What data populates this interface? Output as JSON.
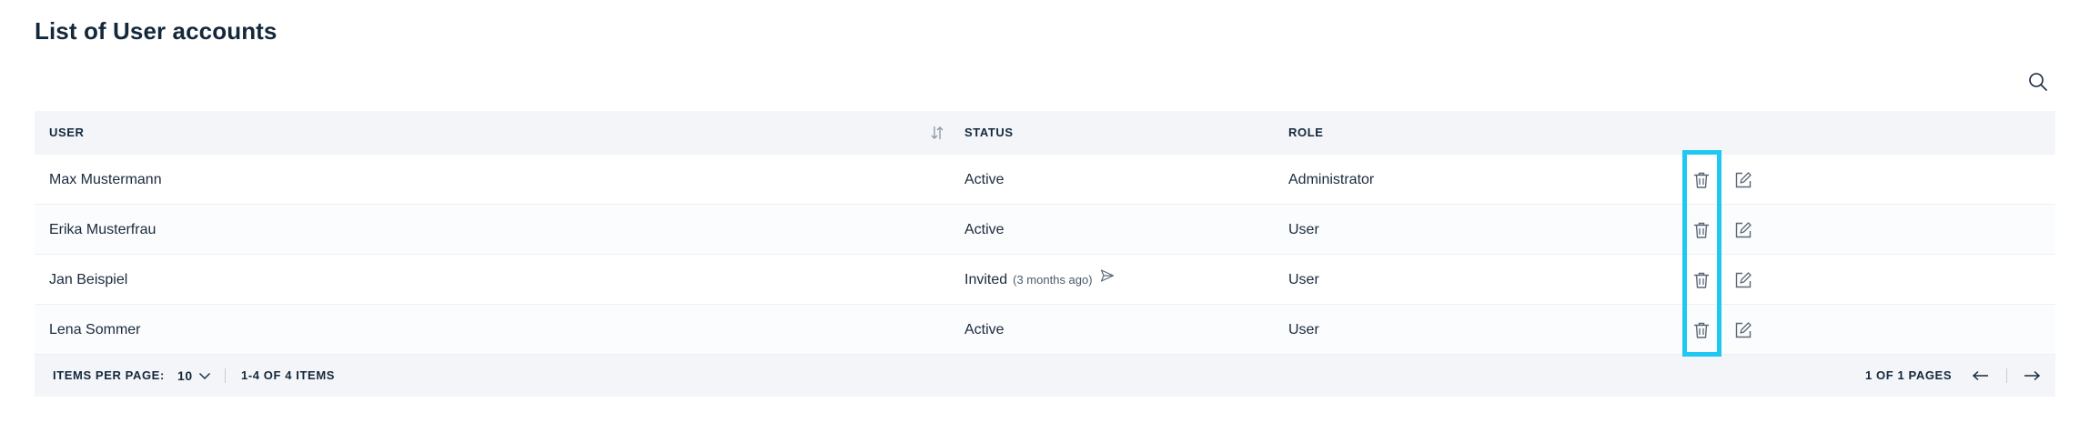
{
  "page": {
    "title": "List of User accounts"
  },
  "table": {
    "headers": {
      "user": "USER",
      "status": "STATUS",
      "role": "ROLE"
    },
    "rows": [
      {
        "user": "Max Mustermann",
        "status": "Active",
        "status_sub": "",
        "role": "Administrator"
      },
      {
        "user": "Erika Musterfrau",
        "status": "Active",
        "status_sub": "",
        "role": "User"
      },
      {
        "user": "Jan Beispiel",
        "status": "Invited",
        "status_sub": "(3 months ago)",
        "role": "User"
      },
      {
        "user": "Lena Sommer",
        "status": "Active",
        "status_sub": "",
        "role": "User"
      }
    ]
  },
  "footer": {
    "items_per_page_label": "ITEMS PER PAGE:",
    "items_per_page_value": "10",
    "range": "1-4 OF 4 ITEMS",
    "pages": "1 OF 1 PAGES"
  },
  "icons": {
    "search": "search-icon",
    "sort": "sort-icon",
    "delete": "trash-icon",
    "edit": "edit-icon",
    "resend": "send-icon",
    "dropdown": "chevron-down-icon",
    "prev": "arrow-left-icon",
    "next": "arrow-right-icon"
  },
  "colors": {
    "text": "#14283c",
    "header_bg": "#f3f5f8",
    "highlight": "#1fc8f2"
  }
}
